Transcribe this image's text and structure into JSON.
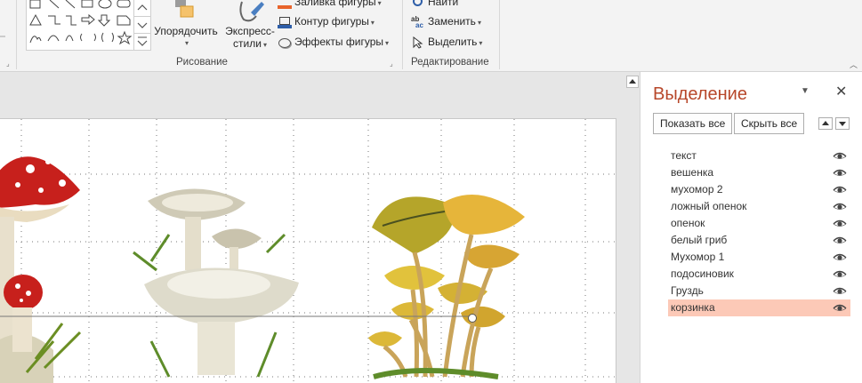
{
  "ribbon": {
    "drawing": {
      "group_label": "Рисование",
      "arrange_label": "Упорядочить",
      "quick_styles_line1": "Экспресс-",
      "quick_styles_line2": "стили",
      "shape_fill": "Заливка фигуры",
      "shape_outline": "Контур фигуры",
      "shape_effects": "Эффекты фигуры"
    },
    "editing": {
      "group_label": "Редактирование",
      "find": "Найти",
      "replace": "Заменить",
      "select": "Выделить"
    }
  },
  "selection_pane": {
    "title": "Выделение",
    "show_all": "Показать все",
    "hide_all": "Скрыть все",
    "items": [
      {
        "label": "текст",
        "selected": false
      },
      {
        "label": "вешенка",
        "selected": false
      },
      {
        "label": "мухомор 2",
        "selected": false
      },
      {
        "label": "ложный опенок",
        "selected": false
      },
      {
        "label": "опенок",
        "selected": false
      },
      {
        "label": "белый гриб",
        "selected": false
      },
      {
        "label": "Мухомор 1",
        "selected": false
      },
      {
        "label": "подосиновик",
        "selected": false
      },
      {
        "label": "Груздь",
        "selected": false
      },
      {
        "label": "корзинка",
        "selected": true
      }
    ]
  },
  "colors": {
    "accent": "#b7472a",
    "selected_row": "#fcc9b7"
  }
}
